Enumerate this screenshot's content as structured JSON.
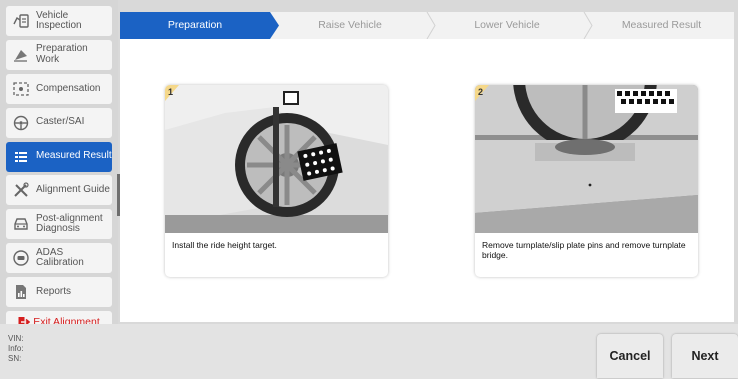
{
  "sidebar": {
    "items": [
      {
        "label": "Vehicle Inspection",
        "icon": "vehicle-inspection-icon",
        "active": false
      },
      {
        "label": "Preparation Work",
        "icon": "preparation-work-icon",
        "active": false
      },
      {
        "label": "Compensation",
        "icon": "compensation-icon",
        "active": false
      },
      {
        "label": "Caster/SAI",
        "icon": "steering-wheel-icon",
        "active": false
      },
      {
        "label": "Measured Result",
        "icon": "list-icon",
        "active": true
      },
      {
        "label": "Alignment Guide",
        "icon": "tools-icon",
        "active": false
      },
      {
        "label": "Post-alignment Diagnosis",
        "icon": "car-icon",
        "active": false
      },
      {
        "label": "ADAS Calibration",
        "icon": "adas-icon",
        "active": false
      },
      {
        "label": "Reports",
        "icon": "report-icon",
        "active": false
      }
    ],
    "exit_label": "Exit Alignment"
  },
  "steps": [
    {
      "label": "Preparation",
      "active": true
    },
    {
      "label": "Raise Vehicle",
      "active": false
    },
    {
      "label": "Lower Vehicle",
      "active": false
    },
    {
      "label": "Measured Result",
      "active": false
    }
  ],
  "cards": [
    {
      "number": "1",
      "caption": "Install the ride height target."
    },
    {
      "number": "2",
      "caption": "Remove turnplate/slip plate pins and remove turnplate bridge."
    }
  ],
  "footer": {
    "vin_label": "VIN:",
    "info_label": "Info:",
    "sn_label": "SN:",
    "cancel_label": "Cancel",
    "next_label": "Next"
  },
  "colors": {
    "accent": "#1b62c4",
    "exit": "#d51e1e",
    "badge": "#f5d88a"
  }
}
